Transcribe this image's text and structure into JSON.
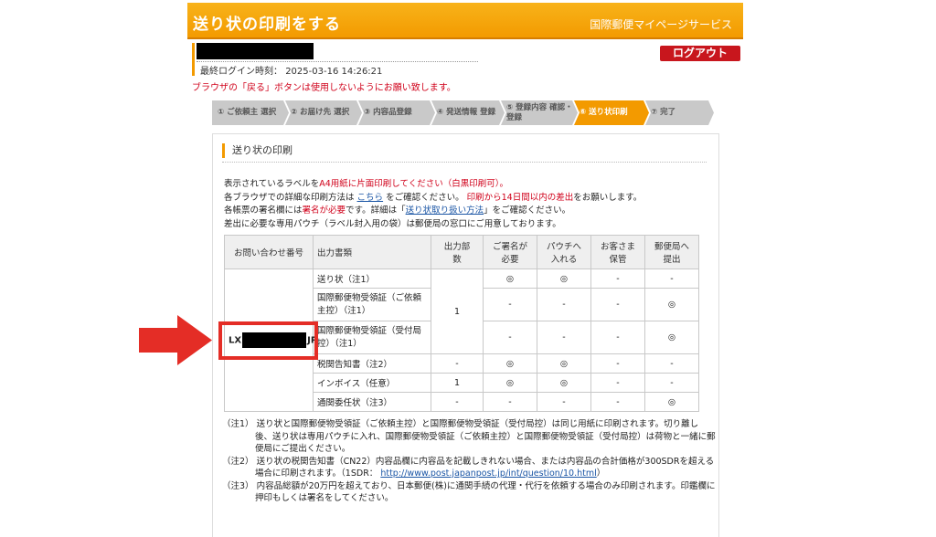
{
  "header": {
    "title": "送り状の印刷をする",
    "service": "国際郵便マイページサービス"
  },
  "user": {
    "last_login_label": "最終ログイン時刻：",
    "last_login_value": "2025-03-16 14:26:21"
  },
  "logout_label": "ログアウト",
  "warning": "ブラウザの「戻る」ボタンは使用しないようにお願い致します。",
  "steps": [
    {
      "label": "① ご依頼主 選択"
    },
    {
      "label": "② お届け先 選択"
    },
    {
      "label": "③ 内容品登録"
    },
    {
      "label": "④ 発送情報 登録"
    },
    {
      "label": "⑤ 登録内容 確認・登録"
    },
    {
      "label": "⑥ 送り状印刷"
    },
    {
      "label": "⑦ 完了"
    }
  ],
  "section_title": "送り状の印刷",
  "instructions": {
    "l1a": "表示されているラベルを",
    "l1b": "A4用紙に片面印刷してください（白黒印刷可）。",
    "l2a": "各ブラウザでの詳細な印刷方法は",
    "l2link": "こちら",
    "l2b": "をご確認ください。",
    "l2c": "印刷から14日間以内の差出",
    "l2d": "をお願いします。",
    "l3a": "各帳票の署名欄には",
    "l3b": "署名が必要",
    "l3c": "です。詳細は「",
    "l3link": "送り状取り扱い方法",
    "l3d": "」をご確認ください。",
    "l4": "差出に必要な専用パウチ（ラベル封入用の袋）は郵便局の窓口にご用意しております。"
  },
  "table": {
    "headers": [
      "お問い合わせ番号",
      "出力書類",
      "出力部数",
      "ご署名が必要",
      "パウチへ入れる",
      "お客さま保管",
      "郵便局へ提出"
    ],
    "tracking_prefix": "LX",
    "tracking_suffix": "JP",
    "rows": [
      {
        "doc": "送り状（注1）",
        "sign": "◎",
        "pouch": "◎",
        "keep": "-",
        "submit": "-"
      },
      {
        "doc": "国際郵便物受領証（ご依頼主控）（注1）",
        "sign": "-",
        "pouch": "-",
        "keep": "-",
        "submit": "◎"
      },
      {
        "doc": "国際郵便物受領証（受付局控）（注1）",
        "sign": "-",
        "pouch": "-",
        "keep": "-",
        "submit": "◎"
      },
      {
        "doc": "税関告知書（注2）",
        "copies": "-",
        "sign": "◎",
        "pouch": "◎",
        "keep": "-",
        "submit": "-"
      },
      {
        "doc": "インボイス（任意）",
        "copies": "1",
        "sign": "◎",
        "pouch": "◎",
        "keep": "-",
        "submit": "-"
      },
      {
        "doc": "通関委任状（注3）",
        "copies": "-",
        "sign": "-",
        "pouch": "-",
        "keep": "-",
        "submit": "◎"
      }
    ],
    "merged_copies": "1"
  },
  "notes": {
    "n1": "（注1） 送り状と国際郵便物受領証（ご依頼主控）と国際郵便物受領証（受付局控）は同じ用紙に印刷されます。切り離し後、送り状は専用パウチに入れ、国際郵便物受領証（ご依頼主控）と国際郵便物受領証（受付局控）は荷物と一緒に郵便局にご提出ください。",
    "n2a": "（注2） 送り状の税関告知書（CN22）内容品欄に内容品を記載しきれない場合、または内容品の合計価格が300SDRを超える場合に印刷されます。（1SDR：",
    "n2link": "http://www.post.japanpost.jp/int/question/10.html",
    "n2b": "）",
    "n3": "（注3） 内容品総額が20万円を超えており、日本郵便(株)に通関手続の代理・代行を依頼する場合のみ印刷されます。印鑑欄に押印もしくは署名をしてください。"
  },
  "colors": {
    "accent": "#f39a00",
    "alert": "#d0021b",
    "arrow": "#e42d26"
  }
}
